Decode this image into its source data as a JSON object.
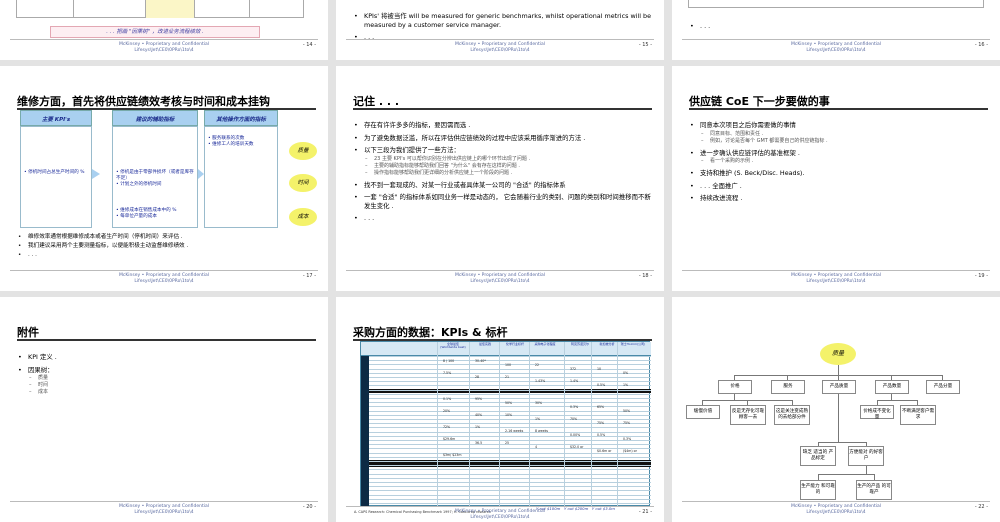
{
  "footer": {
    "line1": "McKinsey  •  Proprietary and Confidential",
    "line2": "Lifesys\\Jet\\CE0\\0PRo\\1to\\4"
  },
  "slide14": {
    "note": ". . . 把画 \"因果树\" ，改进业务流程绩效 .",
    "page": "- 14 -"
  },
  "slide15": {
    "bullet1": "KPIs' 将被当作 will be measured for generic benchmarks, whilst operational metrics will be measured by a customer service manager.",
    "bullet2": ". . .",
    "page": "- 15 -"
  },
  "slide16": {
    "bullet1": ". . .",
    "page": "- 16 -"
  },
  "slide17": {
    "title": "维修方面，首先将供应链绩效考核与时间和成本挂钩",
    "headers": [
      "主要 KPI's",
      "建议的辅助指标",
      "其他操作方面的指标"
    ],
    "col1": "• 停机时间占总生产时间的 %",
    "col2a": "• 停机是由于零部件损坏（或者是库存不足）",
    "col2b": "• 计划之外的停机时间",
    "col2c": "• 维修成本在销售成本中的 %",
    "col2d": "• 每单位产量的成本",
    "col3": "• 服务联系的次数\n• 维修工人的培训天数",
    "blobs": [
      "质量",
      "时间",
      "成本"
    ],
    "bullets": [
      "维修效率通常根据维修成本或者生产时间（停机时间）来评估 .",
      "我们建议采用两个主要测量指标，以便能积极主动监督维修绩效 .",
      ". . ."
    ],
    "page": "- 17 -"
  },
  "slide18": {
    "title": "记住 . . .",
    "bullets": [
      "存在有许许多多的指标，要因需而选 .",
      "为了避免数据泛滥，所以在评估供应链绩效的过程中应该采用循序渐进的方法 .",
      "以下三段为我们提供了一些方法：",
      "找不到一套现成的、对某一行业或者具体某一公司的 \"合适\" 的指标体系",
      "一套 \"合适\" 的指标体系如同业务一样是动态的， 它会随着行业的类别、问题的类别和时间推移而不断发生变化 .",
      ". . ."
    ],
    "sub": [
      "23 主要 KPI's 可以帮你识别在分辨出供应链上的哪个环节出现了问题 .",
      "主要的辅助指标能够帮助我们回答 \"为什么\" 会有存在这样的问题 .",
      "操作指标能够帮助我们更详细的分析供应链上一个阶段的问题 ."
    ],
    "page": "- 18 -"
  },
  "slide19": {
    "title": "供应链 CoE 下一步要做的事",
    "bullets": [
      "同意本次项目之后你需要做的事情",
      "进一步确认供应链评估的基准框架 .",
      "支持和推护  (S. Beck/Disc. Heads).",
      ". . . 全面推广 .",
      "持续改进流程 ."
    ],
    "sub1": [
      "同意目标、范围和责任 .",
      "例如，讨论是否每个 GMT 都需要自己的供应链指标 ."
    ],
    "sub2": [
      "看一个采购的示例 ."
    ],
    "page": "- 19 -"
  },
  "slide20": {
    "title": "附件",
    "bullets": [
      "KPI 定义 .",
      "因果树："
    ],
    "sub": [
      "质量",
      "时间",
      "成本"
    ],
    "page": "- 20 -"
  },
  "slide21": {
    "title": "采购方面的数据：KPIs &  标杆",
    "col_headers": [
      "全球最佳 (Worldwide best)",
      "最佳实践",
      "化学行业标杆",
      "采购电子化程度",
      "阿克苏诺贝尔",
      "新加坡分析",
      "瑞士Holcim(公司)"
    ],
    "cells": [
      "8 / 100",
      "30-40*",
      "100",
      "22",
      "372",
      "10",
      "0%",
      "7.5%",
      "28",
      "21",
      "1.43%",
      "1.4%",
      "0.5%",
      "1%",
      "0.1%",
      "95%",
      "50%",
      "30%",
      "0.3%",
      "65%",
      "50%",
      "20%",
      "40%",
      "10%",
      "1%",
      "70%",
      "75%",
      "75%",
      "72%",
      "1%",
      "2-16 weeks",
      "8 weeks",
      "0.00%",
      "0.5%",
      "0.3%",
      "$29.6m",
      "36.5",
      "25",
      "4",
      "$32.0 or",
      "$0.6m or",
      "($4m) or",
      "$3m/ $23m"
    ],
    "bottom_labels": [
      "Y out $100m",
      "Y out $200m",
      "Y out $3.0m"
    ],
    "source": "A. CAPS Research: Chemical Purchasing Benchmark 1997; H. Cost-drop research",
    "page": "- 21 -"
  },
  "slide22": {
    "root": "质量",
    "level1": [
      "价格",
      "服务",
      "产品质量",
      "产品数量",
      "产品分量"
    ],
    "level2": [
      "缓慢价值",
      "反是无存化可靠顾客一去",
      "这是关注变成熟的去给部分件",
      "价格成不变化量",
      "不断满足客户需求"
    ],
    "level3": [
      "缺乏 适当的 产品标定",
      "方便能对 的好客户"
    ],
    "level4": [
      "生产能力 和可靠的",
      "生产的产品 的可靠产"
    ],
    "page": "- 22 -"
  },
  "icons": {
    "zoom": "magnifier-icon"
  }
}
